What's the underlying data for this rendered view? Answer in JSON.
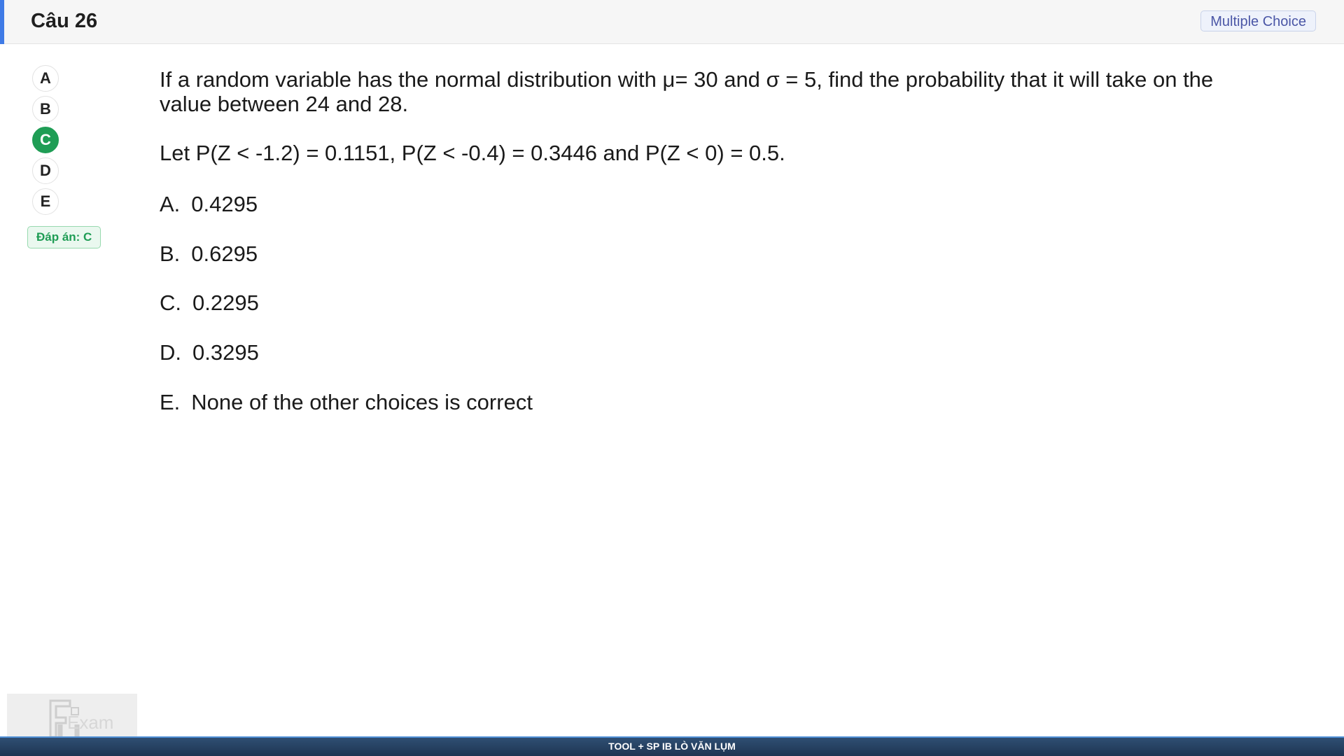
{
  "header": {
    "title": "Câu 26",
    "question_type": "Multiple Choice"
  },
  "option_buttons": [
    {
      "letter": "A",
      "selected": false
    },
    {
      "letter": "B",
      "selected": false
    },
    {
      "letter": "C",
      "selected": true
    },
    {
      "letter": "D",
      "selected": false
    },
    {
      "letter": "E",
      "selected": false
    }
  ],
  "answer_badge": "Đáp án: C",
  "question": {
    "text": "If a random variable has the normal distribution with μ= 30 and σ = 5, find the probability that it will take on the value between 24 and 28.",
    "hint": "Let P(Z < -1.2) = 0.1151, P(Z < -0.4) = 0.3446 and P(Z < 0) = 0.5."
  },
  "choices": [
    {
      "letter": "A.",
      "text": "0.4295"
    },
    {
      "letter": "B.",
      "text": "0.6295"
    },
    {
      "letter": "C.",
      "text": "0.2295"
    },
    {
      "letter": "D.",
      "text": "0.3295"
    },
    {
      "letter": "E.",
      "text": "None of the other choices is correct"
    }
  ],
  "watermark": {
    "logo_text": "Exam",
    "icon": "fu-exam-logo-icon"
  },
  "footer": {
    "text": "TOOL + SP IB LÒ VĂN LỤM"
  },
  "colors": {
    "accent": "#3f7be6",
    "selected": "#1f9d55",
    "footer": "#1e3552"
  }
}
